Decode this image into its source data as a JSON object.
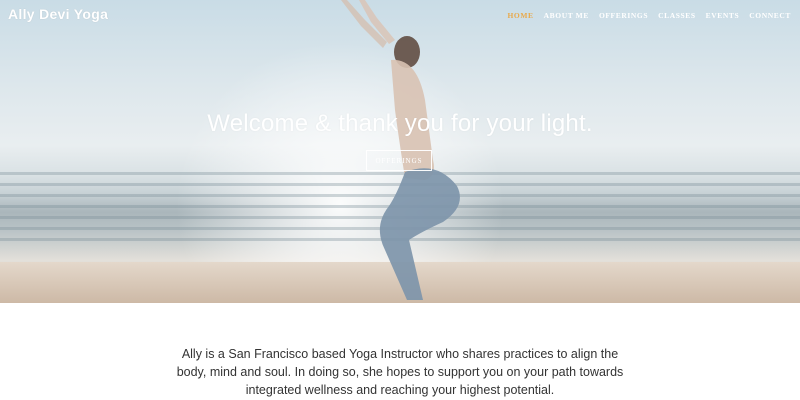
{
  "site": {
    "logo": "Ally Devi Yoga"
  },
  "nav": {
    "items": [
      {
        "label": "HOME",
        "active": true
      },
      {
        "label": "ABOUT ME",
        "active": false
      },
      {
        "label": "OFFERINGS",
        "active": false
      },
      {
        "label": "CLASSES",
        "active": false
      },
      {
        "label": "EVENTS",
        "active": false
      },
      {
        "label": "CONNECT",
        "active": false
      }
    ]
  },
  "hero": {
    "title": "Welcome & thank you for your light.",
    "button_label": "OFFERINGS"
  },
  "intro": {
    "text": "Ally is a San Francisco based Yoga Instructor who shares practices to align the body, mind and soul. In doing so, she hopes to support you on your path towards integrated wellness and reaching your highest potential."
  },
  "colors": {
    "accent": "#e9a94b",
    "text": "#333333"
  }
}
